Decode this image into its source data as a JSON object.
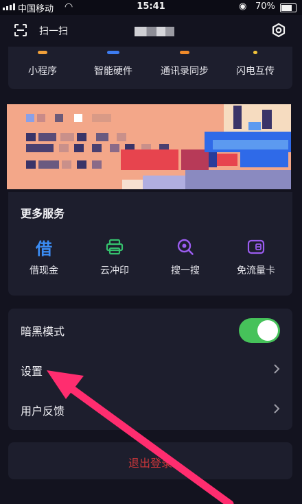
{
  "status_bar": {
    "carrier": "中国移动",
    "time": "15:41",
    "battery": "70%"
  },
  "header": {
    "scan_label": "扫一扫"
  },
  "top_items": [
    {
      "label": "小程序",
      "color": "#f0a03a"
    },
    {
      "label": "智能硬件",
      "color": "#3d7cf0"
    },
    {
      "label": "通讯录同步",
      "color": "#f08a2a"
    },
    {
      "label": "闪电互传",
      "color": "#f0c23a"
    }
  ],
  "services": {
    "title": "更多服务",
    "items": [
      {
        "label": "借现金",
        "glyph": "借",
        "color": "#3b8df5"
      },
      {
        "label": "云冲印",
        "color": "#35c16d"
      },
      {
        "label": "搜一搜",
        "color": "#9b5cf0"
      },
      {
        "label": "免流量卡",
        "color": "#9b5cf0"
      }
    ]
  },
  "settings": {
    "dark_mode_label": "暗黑模式",
    "dark_mode_on": true,
    "settings_label": "设置",
    "feedback_label": "用户反馈"
  },
  "logout_label": "退出登录",
  "colors": {
    "background": "#13131f",
    "card": "#1d1e2d",
    "toggle_on": "#46c25a",
    "arrow": "#ff2d6f"
  }
}
